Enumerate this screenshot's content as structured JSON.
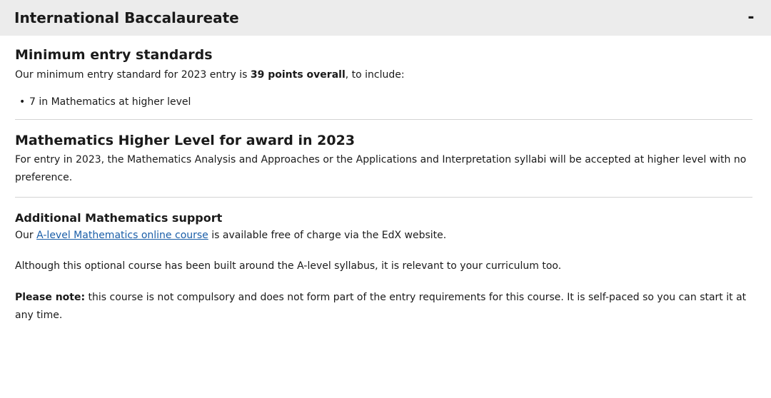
{
  "header": {
    "title": "International Baccalaureate",
    "toggle_symbol": "-"
  },
  "section_min_entry": {
    "heading": "Minimum entry standards",
    "text_prefix": "Our minimum entry standard for 2023 entry is ",
    "text_bold": "39 points overall",
    "text_suffix": ", to include:",
    "requirements": [
      "7 in Mathematics at higher level"
    ]
  },
  "section_hl": {
    "heading": "Mathematics Higher Level for award in 2023",
    "text": "For entry in 2023, the Mathematics Analysis and Approaches or the Applications and Interpretation syllabi will be accepted at higher level with no preference."
  },
  "section_support": {
    "heading": "Additional Mathematics support",
    "para1_prefix": "Our ",
    "link_text": "A-level Mathematics online course",
    "para1_suffix": " is available free of charge via the EdX website.",
    "para2": "Although this optional course has been built around the A-level syllabus, it is relevant to your curriculum too.",
    "note_label": "Please note:",
    "note_text": " this course is not compulsory and does not form part of the entry requirements for this course. It is self-paced so you can start it at any time."
  },
  "colors": {
    "header_bg": "#ececec",
    "link": "#1a5ea8",
    "divider": "#d4d4d4"
  }
}
